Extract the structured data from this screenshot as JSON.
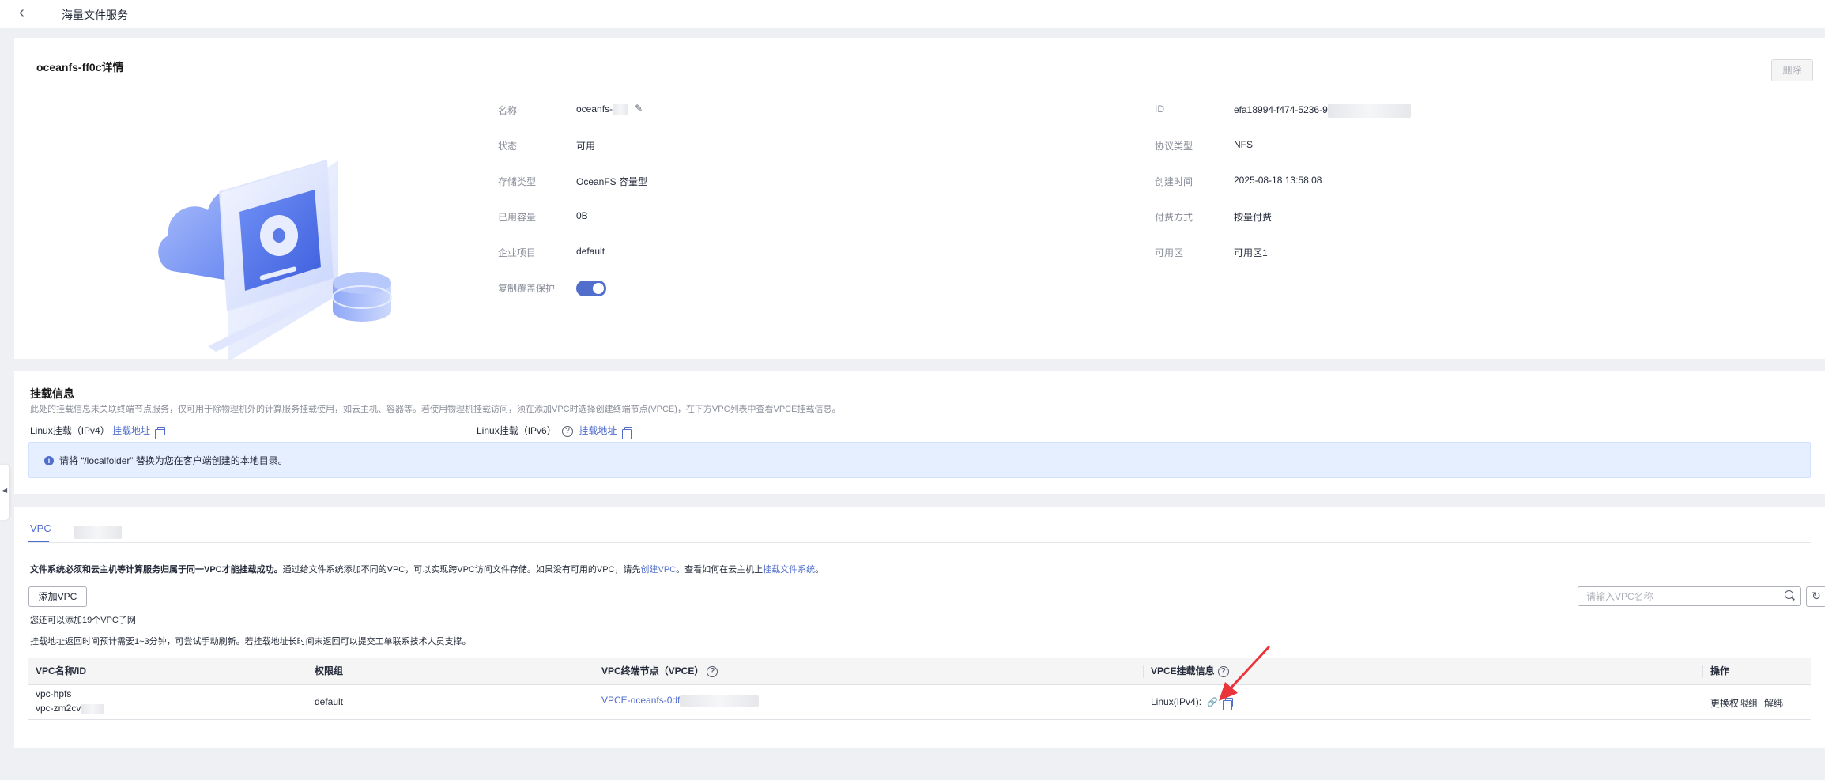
{
  "topbar": {
    "back_icon": "chevron-left-icon",
    "title": "海量文件服务"
  },
  "detail": {
    "title": "oceanfs-ff0c详情",
    "delete_label": "删除",
    "left": [
      {
        "label": "名称",
        "value": "oceanfs-"
      },
      {
        "label": "状态",
        "value": "可用"
      },
      {
        "label": "存储类型",
        "value": "OceanFS 容量型"
      },
      {
        "label": "已用容量",
        "value": "0B"
      },
      {
        "label": "企业项目",
        "value": "default"
      },
      {
        "label": "复制覆盖保护",
        "value": ""
      }
    ],
    "right": [
      {
        "label": "ID",
        "value": "efa18994-f474-5236-9"
      },
      {
        "label": "协议类型",
        "value": "NFS"
      },
      {
        "label": "创建时间",
        "value": "2025-08-18 13:58:08"
      },
      {
        "label": "付费方式",
        "value": "按量付费"
      },
      {
        "label": "可用区",
        "value": "可用区1"
      }
    ],
    "overwrite_protect_enabled": true,
    "accent_color": "#526ecc"
  },
  "mount": {
    "title": "挂载信息",
    "desc": "此处的挂载信息未关联终端节点服务，仅可用于除物理机外的计算服务挂载使用，如云主机、容器等。若使用物理机挂载访问，须在添加VPC时选择创建终端节点(VPCE)，在下方VPC列表中查看VPCE挂载信息。",
    "ipv4_label": "Linux挂载（IPv4）",
    "ipv4_link": "挂载地址",
    "ipv6_label": "Linux挂载（IPv6）",
    "ipv6_link": "挂载地址",
    "info_text": "请将 “/localfolder” 替换为您在客户端创建的本地目录。"
  },
  "vpc": {
    "tab_label": "VPC",
    "note_bold": "文件系统必须和云主机等计算服务归属于同一VPC才能挂载成功。",
    "note_mid": "通过给文件系统添加不同的VPC，可以实现跨VPC访问文件存储。如果没有可用的VPC，请先",
    "note_link1": "创建VPC",
    "note_mid2": "。查看如何在云主机上",
    "note_link2": "挂载文件系统",
    "note_end": "。",
    "add_button": "添加VPC",
    "remain": "您还可以添加19个VPC子网",
    "time_note": "挂载地址返回时间预计需要1~3分钟，可尝试手动刷新。若挂载地址长时间未返回可以提交工单联系技术人员支撑。",
    "search_placeholder": "请输入VPC名称",
    "columns": [
      "VPC名称/ID",
      "权限组",
      "VPC终端节点（VPCE）",
      "VPCE挂载信息",
      "操作"
    ],
    "rows": [
      {
        "vpc_name": "vpc-hpfs",
        "vpc_id": "vpc-zm2cv",
        "perm_group": "default",
        "vpce": "VPCE-oceanfs-0df",
        "mount_info": "Linux(IPv4):",
        "actions": [
          "更换权限组",
          "解绑"
        ]
      }
    ]
  }
}
